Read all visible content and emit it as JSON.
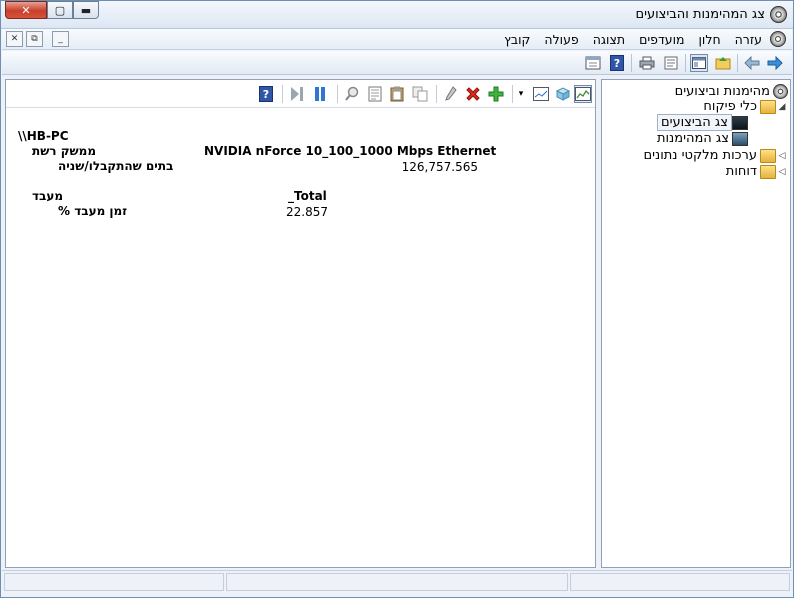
{
  "window": {
    "title": "צג המהימנות והביצועים",
    "caption_buttons": {
      "close": "✕",
      "maximize": "▢",
      "minimize": "▬"
    }
  },
  "menubar": {
    "items": [
      "קובץ",
      "פעולה",
      "תצוגה",
      "מועדפים",
      "חלון",
      "עזרה"
    ],
    "mdi_buttons": {
      "close": "✕",
      "restore": "⧉",
      "minimize": "_"
    }
  },
  "toolbar": {
    "icons": [
      "forward-arrow-icon",
      "back-arrow-icon",
      "up-folder-icon",
      "show-hide-tree-icon",
      "properties-icon",
      "print-icon",
      "help-icon",
      "export-list-icon"
    ]
  },
  "content_toolbar": {
    "icons": [
      "view-graph-icon",
      "freeze-icon",
      "chart-options-icon",
      "dropdown-arrow-icon",
      "add-counter-icon",
      "delete-counter-icon",
      "highlight-icon",
      "copy-properties-icon",
      "paste-counter-icon",
      "properties-icon",
      "zoom-icon",
      "pause-icon",
      "next-icon",
      "help-icon"
    ]
  },
  "report": {
    "computer": "\\\\HB-PC",
    "groups": [
      {
        "object": "ממשק רשת",
        "instance": "NVIDIA nForce 10_100_1000 Mbps Ethernet",
        "counter": "בתים שהתקבלו/שניה",
        "value": "126,757.565"
      },
      {
        "object": "מעבד",
        "instance": "_Total",
        "counter": "זמן מעבד %",
        "value": "22.857"
      }
    ]
  },
  "tree": {
    "nodes": [
      {
        "label": "מהימנות וביצועים",
        "level": 0,
        "icon": "performance-monitor-icon"
      },
      {
        "label": "כלי פיקוח",
        "level": 1,
        "icon": "folder-icon",
        "expanded": true
      },
      {
        "label": "צג הביצועים",
        "level": 2,
        "icon": "performance-monitor-chart-icon",
        "selected": true
      },
      {
        "label": "צג המהימנות",
        "level": 2,
        "icon": "reliability-monitor-icon"
      },
      {
        "label": "ערכות מלקטי נתונים",
        "level": 1,
        "icon": "folder-icon",
        "expanded": false
      },
      {
        "label": "דוחות",
        "level": 1,
        "icon": "folder-icon",
        "expanded": false
      }
    ]
  },
  "colors": {
    "window_border": "#6d8fb3",
    "close_button": "#c8402b",
    "pane_border": "#8ea1b8",
    "toolbar_gradient_top": "#fafcfe",
    "toolbar_gradient_bottom": "#e2eaf4"
  }
}
